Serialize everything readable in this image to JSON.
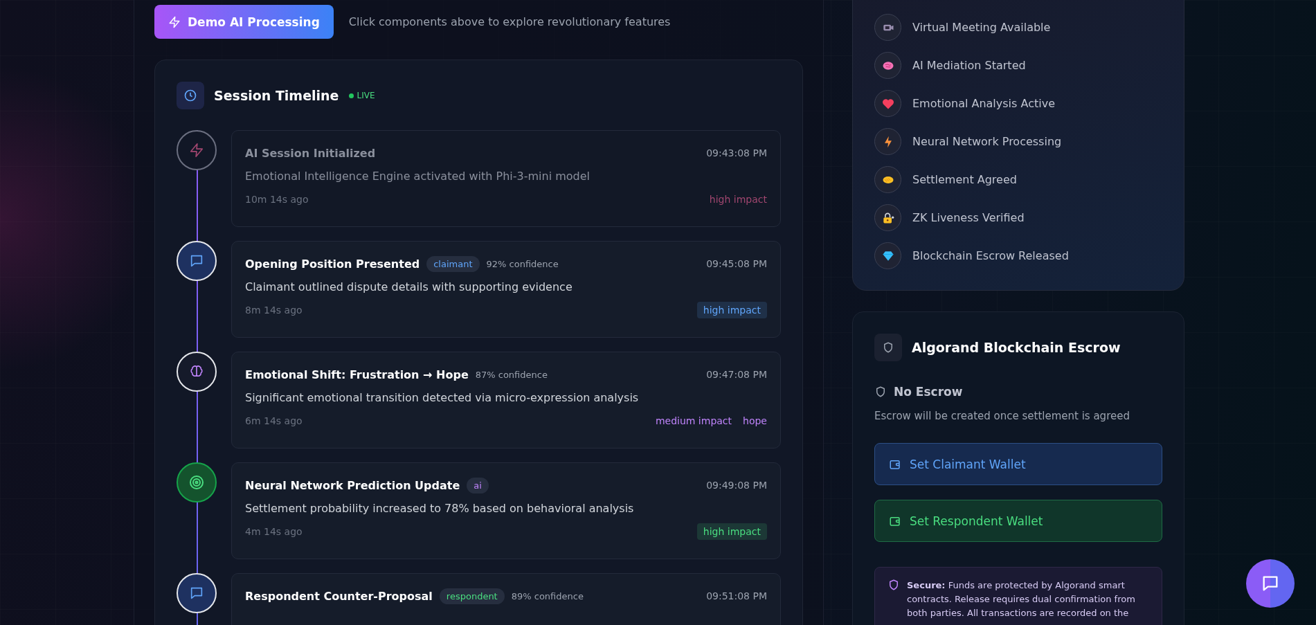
{
  "demo_button": {
    "label": "Demo AI Processing"
  },
  "hint": "Click components above to explore revolutionary features",
  "timeline": {
    "title": "Session Timeline",
    "live": "LIVE",
    "events": [
      {
        "kind": "system",
        "faded": true,
        "title": "AI Session Initialized",
        "time": "09:43:08 PM",
        "description": "Emotional Intelligence Engine activated with Phi-3-mini model",
        "ago": "10m 14s ago",
        "tags": [
          {
            "label": "high impact",
            "color": "#a0466f",
            "filled": false
          }
        ]
      },
      {
        "kind": "claimant",
        "faded": false,
        "title": "Opening Position Presented",
        "role": {
          "label": "claimant",
          "color": "#60a5fa"
        },
        "confidence": "92% confidence",
        "time": "09:45:08 PM",
        "description": "Claimant outlined dispute details with supporting evidence",
        "ago": "8m 14s ago",
        "tags": [
          {
            "label": "high impact",
            "color": "#60a5fa",
            "filled": true
          }
        ]
      },
      {
        "kind": "emotion",
        "faded": false,
        "title": "Emotional Shift: Frustration → Hope",
        "confidence": "87% confidence",
        "time": "09:47:08 PM",
        "description": "Significant emotional transition detected via micro-expression analysis",
        "ago": "6m 14s ago",
        "tags": [
          {
            "label": "medium impact",
            "color": "#c084fc",
            "filled": false
          },
          {
            "label": "hope",
            "color": "#c084fc",
            "filled": false
          }
        ]
      },
      {
        "kind": "ai",
        "faded": false,
        "title": "Neural Network Prediction Update",
        "role": {
          "label": "ai",
          "color": "#c084fc"
        },
        "time": "09:49:08 PM",
        "description": "Settlement probability increased to 78% based on behavioral analysis",
        "ago": "4m 14s ago",
        "tags": [
          {
            "label": "high impact",
            "color": "#4ade80",
            "filled": true
          }
        ]
      },
      {
        "kind": "respondent",
        "faded": false,
        "title": "Respondent Counter-Proposal",
        "role": {
          "label": "respondent",
          "color": "#4ade80"
        },
        "confidence": "89% confidence",
        "time": "09:51:08 PM"
      }
    ]
  },
  "milestones": [
    {
      "kind": "camera",
      "label": "Virtual Meeting Available"
    },
    {
      "kind": "brain",
      "label": "AI Mediation Started"
    },
    {
      "kind": "heart",
      "label": "Emotional Analysis Active"
    },
    {
      "kind": "bolt",
      "label": "Neural Network Processing"
    },
    {
      "kind": "handshake",
      "label": "Settlement Agreed"
    },
    {
      "kind": "lock",
      "label": "ZK Liveness Verified"
    },
    {
      "kind": "diamond",
      "label": "Blockchain Escrow Released"
    }
  ],
  "escrow": {
    "title": "Algorand Blockchain Escrow",
    "status": "No Escrow",
    "description": "Escrow will be created once settlement is agreed",
    "buttons": [
      {
        "kind": "claimant",
        "label": "Set Claimant Wallet"
      },
      {
        "kind": "respondent",
        "label": "Set Respondent Wallet"
      }
    ],
    "note": "**Secure:** Funds are protected by Algorand smart contracts. Release requires dual confirmation from both parties. All transactions are recorded on the"
  }
}
